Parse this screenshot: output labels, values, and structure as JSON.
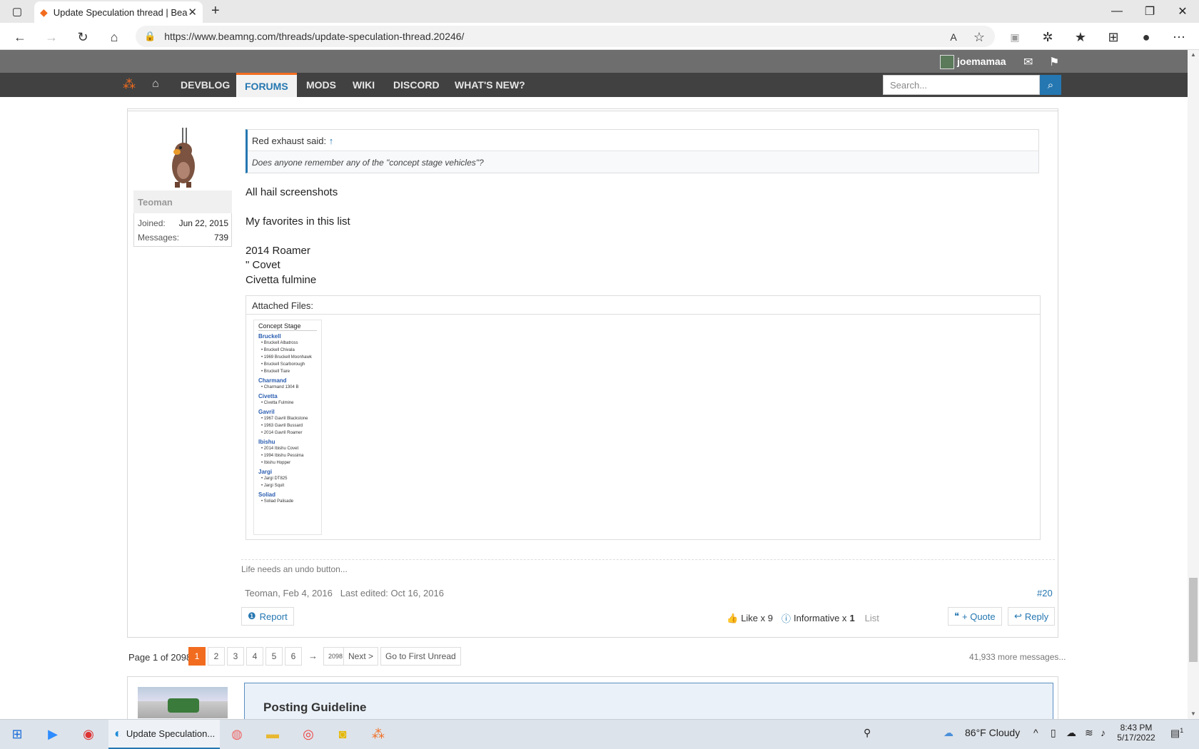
{
  "browser": {
    "tab_title": "Update Speculation thread | Bea",
    "url": "https://www.beamng.com/threads/update-speculation-thread.20246/"
  },
  "site": {
    "username": "joemamaa",
    "nav": {
      "devblog": "DEVBLOG",
      "forums": "FORUMS",
      "mods": "MODS",
      "wiki": "WIKI",
      "discord": "DISCORD",
      "whats_new": "WHAT'S NEW?"
    },
    "search_placeholder": "Search..."
  },
  "post": {
    "author": "Teoman",
    "joined_label": "Joined:",
    "joined_value": "Jun 22, 2015",
    "messages_label": "Messages:",
    "messages_value": "739",
    "quote_author": "Red exhaust said:",
    "quote_arrow": "↑",
    "quote_text": "Does anyone remember any of the \"concept stage vehicles\"?",
    "lines": [
      "All hail screenshots",
      "My favorites in this list",
      "2014 Roamer",
      "\" Covet",
      "Civetta fulmine"
    ],
    "attached_label": "Attached Files:",
    "attachment": {
      "title": "Concept Stage",
      "groups": [
        {
          "name": "Bruckell",
          "items": [
            "Bruckell Albatross",
            "Bruckell Chivala",
            "1969 Bruckell Moonhawk",
            "Bruckell Scarborough",
            "Bruckell Tiare"
          ]
        },
        {
          "name": "Charmand",
          "items": [
            "Charmand 1304 B"
          ]
        },
        {
          "name": "Civetta",
          "items": [
            "Civetta Fulmine"
          ]
        },
        {
          "name": "Gavril",
          "items": [
            "1967 Gavril Blackstone",
            "1963 Gavril Bussard",
            "2014 Gavril Roamer"
          ]
        },
        {
          "name": "Ibishu",
          "items": [
            "2014 Ibishu Covet",
            "1994 Ibishu Pessima",
            "Ibishu Hopper"
          ]
        },
        {
          "name": "Jargi",
          "items": [
            "Jargi DT825",
            "Jargi Squit"
          ]
        },
        {
          "name": "Soliad",
          "items": [
            "Soliad Palisade"
          ]
        }
      ]
    },
    "signature": "Life needs an undo button...",
    "meta": "Teoman, Feb 4, 2016",
    "last_edited": "Last edited: Oct 16, 2016",
    "number": "#20",
    "report": "Report",
    "like_label": "Like x 9",
    "informative_prefix": "Informative x",
    "informative_count": "1",
    "list": "List",
    "quote_btn": "+ Quote",
    "reply_btn": "Reply"
  },
  "pagination": {
    "label": "Page 1 of 2098",
    "pages": [
      "1",
      "2",
      "3",
      "4",
      "5",
      "6"
    ],
    "arrow": "→",
    "last": "2098",
    "next": "Next >",
    "first_unread": "Go to First Unread",
    "more": "41,933 more messages..."
  },
  "next_post": {
    "guide_title": "Posting Guideline"
  },
  "taskbar": {
    "edge_label": "Update Speculation...",
    "weather": "86°F  Cloudy",
    "time": "8:43 PM",
    "date": "5/17/2022",
    "notif_count": "1"
  }
}
